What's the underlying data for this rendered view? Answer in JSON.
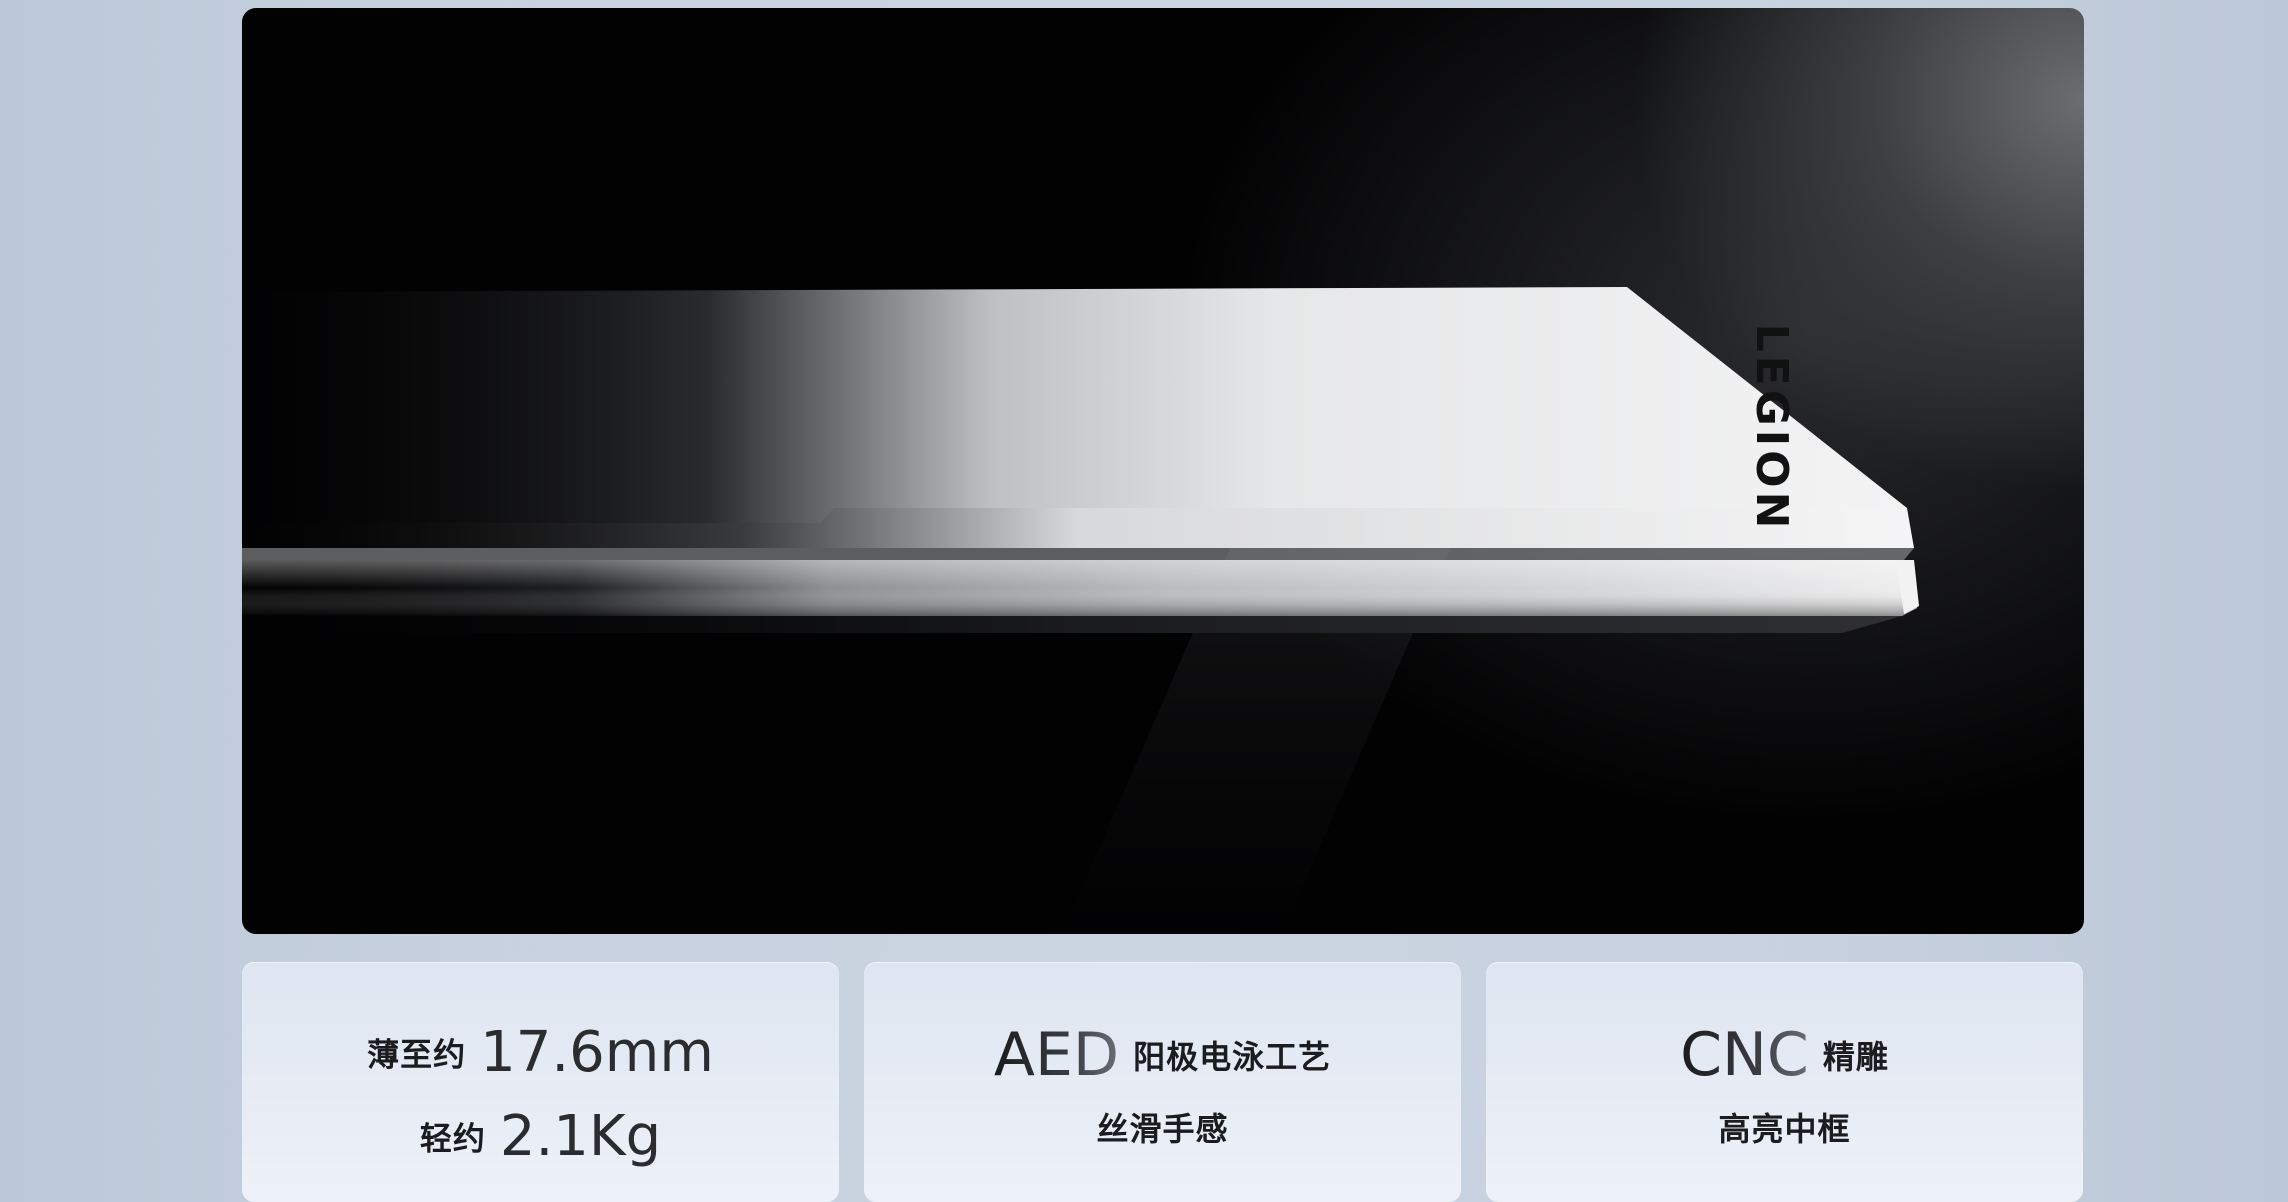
{
  "hero": {
    "logo_text": "LEGION"
  },
  "features": [
    {
      "line1_label": "薄至约",
      "line1_value": "17.6mm",
      "line2_label": "轻约",
      "line2_value": "2.1Kg"
    },
    {
      "line1_big": "AED",
      "line1_label": "阳极电泳工艺",
      "line2_text": "丝滑手感"
    },
    {
      "line1_big": "CNC",
      "line1_label": "精雕",
      "line2_text": "高亮中框"
    }
  ]
}
